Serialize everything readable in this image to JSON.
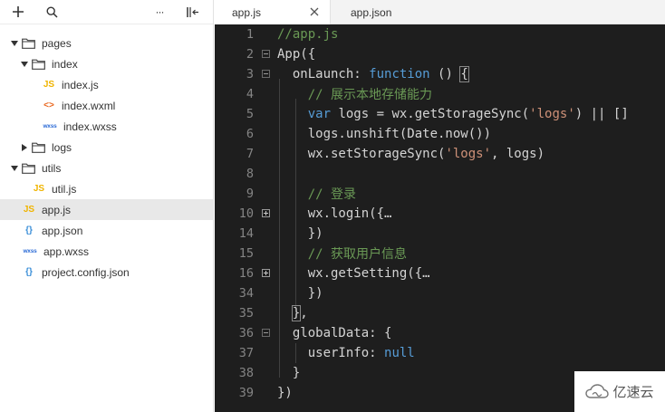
{
  "sidebar": {
    "toolbar": {
      "add": "+",
      "more": "···"
    },
    "tree": [
      {
        "label": "pages",
        "type": "folder",
        "expanded": true,
        "depth": 0
      },
      {
        "label": "index",
        "type": "folder",
        "expanded": true,
        "depth": 1
      },
      {
        "label": "index.js",
        "type": "js",
        "icon_text": "JS",
        "depth": 2
      },
      {
        "label": "index.wxml",
        "type": "wxml",
        "icon_text": "<>",
        "depth": 2
      },
      {
        "label": "index.wxss",
        "type": "wxss",
        "icon_text": "wxss",
        "depth": 2
      },
      {
        "label": "logs",
        "type": "folder",
        "expanded": false,
        "depth": 1
      },
      {
        "label": "utils",
        "type": "folder",
        "expanded": true,
        "depth": 0
      },
      {
        "label": "util.js",
        "type": "js",
        "icon_text": "JS",
        "depth": 1
      },
      {
        "label": "app.js",
        "type": "js",
        "icon_text": "JS",
        "depth": 0,
        "selected": true
      },
      {
        "label": "app.json",
        "type": "json",
        "icon_text": "{}",
        "depth": 0
      },
      {
        "label": "app.wxss",
        "type": "wxss",
        "icon_text": "wxss",
        "depth": 0
      },
      {
        "label": "project.config.json",
        "type": "json",
        "icon_text": "{}",
        "depth": 0
      }
    ]
  },
  "editor": {
    "tabs": [
      {
        "label": "app.js",
        "active": true
      },
      {
        "label": "app.json",
        "active": false
      }
    ],
    "lines": [
      {
        "num": "1",
        "fold": "",
        "tokens": [
          {
            "t": "//app.js",
            "c": "comment"
          }
        ]
      },
      {
        "num": "2",
        "fold": "minus",
        "tokens": [
          {
            "t": "App({",
            "c": "plain"
          }
        ]
      },
      {
        "num": "3",
        "fold": "minus",
        "tokens": [
          {
            "t": "  onLaunch: ",
            "c": "plain"
          },
          {
            "t": "function",
            "c": "keyword"
          },
          {
            "t": " () ",
            "c": "plain"
          },
          {
            "t": "{",
            "c": "bracket"
          }
        ]
      },
      {
        "num": "4",
        "fold": "",
        "tokens": [
          {
            "t": "    // 展示本地存储能力",
            "c": "comment"
          }
        ]
      },
      {
        "num": "5",
        "fold": "",
        "tokens": [
          {
            "t": "    ",
            "c": "plain"
          },
          {
            "t": "var",
            "c": "keyword"
          },
          {
            "t": " logs = wx.getStorageSync(",
            "c": "plain"
          },
          {
            "t": "'logs'",
            "c": "string"
          },
          {
            "t": ") || []",
            "c": "plain"
          }
        ]
      },
      {
        "num": "6",
        "fold": "",
        "tokens": [
          {
            "t": "    logs.unshift(Date.now())",
            "c": "plain"
          }
        ]
      },
      {
        "num": "7",
        "fold": "",
        "tokens": [
          {
            "t": "    wx.setStorageSync(",
            "c": "plain"
          },
          {
            "t": "'logs'",
            "c": "string"
          },
          {
            "t": ", logs)",
            "c": "plain"
          }
        ]
      },
      {
        "num": "8",
        "fold": "",
        "tokens": []
      },
      {
        "num": "9",
        "fold": "",
        "tokens": [
          {
            "t": "    // 登录",
            "c": "comment"
          }
        ]
      },
      {
        "num": "10",
        "fold": "plus",
        "tokens": [
          {
            "t": "    wx.login({…",
            "c": "plain"
          }
        ]
      },
      {
        "num": "14",
        "fold": "",
        "tokens": [
          {
            "t": "    })",
            "c": "plain"
          }
        ]
      },
      {
        "num": "15",
        "fold": "",
        "tokens": [
          {
            "t": "    // 获取用户信息",
            "c": "comment"
          }
        ]
      },
      {
        "num": "16",
        "fold": "plus",
        "tokens": [
          {
            "t": "    wx.getSetting({…",
            "c": "plain"
          }
        ]
      },
      {
        "num": "34",
        "fold": "",
        "tokens": [
          {
            "t": "    })",
            "c": "plain"
          }
        ]
      },
      {
        "num": "35",
        "fold": "",
        "tokens": [
          {
            "t": "  ",
            "c": "plain"
          },
          {
            "t": "}",
            "c": "bracket"
          },
          {
            "t": ",",
            "c": "plain"
          }
        ]
      },
      {
        "num": "36",
        "fold": "minus",
        "tokens": [
          {
            "t": "  globalData: {",
            "c": "plain"
          }
        ]
      },
      {
        "num": "37",
        "fold": "",
        "tokens": [
          {
            "t": "    userInfo: ",
            "c": "plain"
          },
          {
            "t": "null",
            "c": "keyword"
          }
        ]
      },
      {
        "num": "38",
        "fold": "",
        "tokens": [
          {
            "t": "  }",
            "c": "plain"
          }
        ]
      },
      {
        "num": "39",
        "fold": "",
        "tokens": [
          {
            "t": "})",
            "c": "plain"
          }
        ]
      }
    ]
  },
  "watermark": {
    "text": "亿速云"
  },
  "colors": {
    "editor_bg": "#1e1e1e",
    "comment": "#6a9955",
    "keyword": "#569cd6",
    "string": "#ce9178",
    "selected_row": "#e8e8e8"
  }
}
